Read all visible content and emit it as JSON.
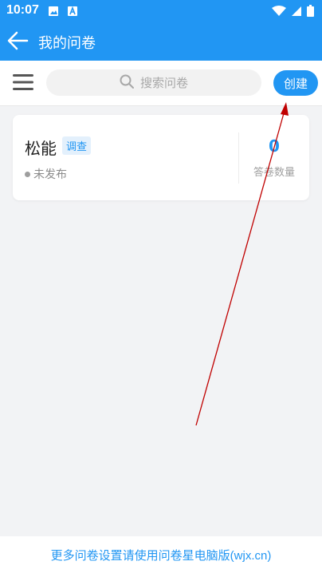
{
  "status_bar": {
    "time": "10:07",
    "left_icons": [
      "image-icon",
      "font-icon"
    ],
    "right_icons": [
      "wifi-icon",
      "signal-icon",
      "battery-icon"
    ]
  },
  "app_bar": {
    "title": "我的问卷",
    "back_icon": "back-arrow-icon"
  },
  "toolbar": {
    "menu_icon": "menu-icon",
    "search_placeholder": "搜索问卷",
    "create_label": "创建"
  },
  "surveys": [
    {
      "title": "松能",
      "type": "调查",
      "status": "未发布",
      "answer_count": "0",
      "answer_count_label": "答卷数量"
    }
  ],
  "footer": {
    "text": "更多问卷设置请使用问卷星电脑版(wjx.cn)"
  },
  "colors": {
    "primary": "#2196f3",
    "background": "#f2f3f5",
    "annotation_arrow": "#c00000"
  }
}
